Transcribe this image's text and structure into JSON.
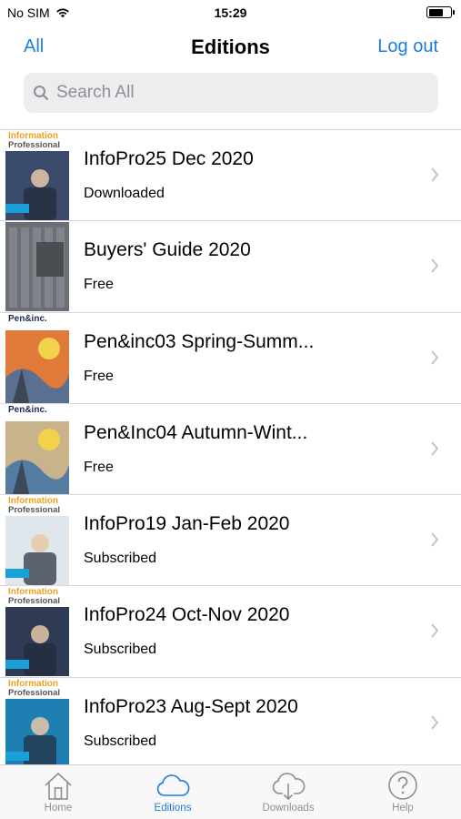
{
  "status_bar": {
    "carrier": "No SIM",
    "time": "15:29",
    "battery_level": 0.7
  },
  "nav": {
    "left": "All",
    "title": "Editions",
    "right": "Log out"
  },
  "search": {
    "placeholder": "Search All"
  },
  "editions": [
    {
      "title": "InfoPro25 Dec 2020",
      "status": "Downloaded",
      "cover": "infopro",
      "cover_color": "#3a4a6a",
      "masthead": "Information",
      "masthead2": "Professional"
    },
    {
      "title": "Buyers' Guide 2020",
      "status": "Free",
      "cover": "buyers",
      "cover_color": "#6c6f75",
      "masthead": "",
      "masthead2": ""
    },
    {
      "title": "Pen&inc03 Spring-Summ...",
      "status": "Free",
      "cover": "peninc",
      "cover_color": "#e07a3a",
      "masthead": "Pen&inc.",
      "masthead2": ""
    },
    {
      "title": "Pen&Inc04 Autumn-Wint...",
      "status": "Free",
      "cover": "peninc",
      "cover_color": "#c9b38a",
      "masthead": "Pen&inc.",
      "masthead2": ""
    },
    {
      "title": "InfoPro19 Jan-Feb 2020",
      "status": "Subscribed",
      "cover": "infopro",
      "cover_color": "#dfe6ec",
      "masthead": "Information",
      "masthead2": "Professional"
    },
    {
      "title": "InfoPro24 Oct-Nov 2020",
      "status": "Subscribed",
      "cover": "infopro",
      "cover_color": "#2f3a55",
      "masthead": "Information",
      "masthead2": "Professional"
    },
    {
      "title": "InfoPro23 Aug-Sept 2020",
      "status": "Subscribed",
      "cover": "infopro",
      "cover_color": "#1f7fb3",
      "masthead": "Information",
      "masthead2": "Professional"
    }
  ],
  "tabs": [
    {
      "label": "Home",
      "icon": "house-icon",
      "active": false
    },
    {
      "label": "Editions",
      "icon": "cloud-icon",
      "active": true
    },
    {
      "label": "Downloads",
      "icon": "cloud-download-icon",
      "active": false
    },
    {
      "label": "Help",
      "icon": "question-circle-icon",
      "active": false
    }
  ],
  "colors": {
    "accent": "#1a7ee0",
    "inactive": "#8e8e93",
    "cover_orange": "#f0a020"
  }
}
